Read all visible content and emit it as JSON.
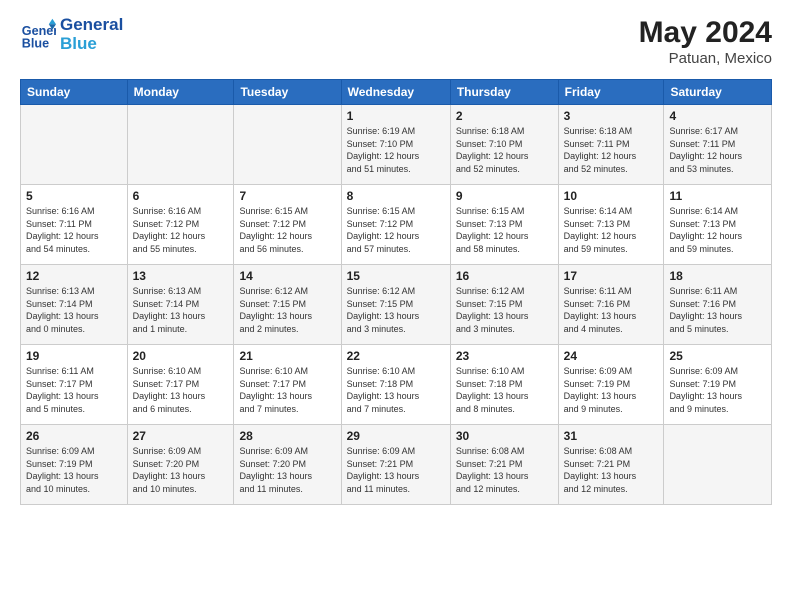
{
  "logo": {
    "name": "GeneralBlue",
    "line1": "General",
    "line2": "Blue"
  },
  "title": {
    "month_year": "May 2024",
    "location": "Patuan, Mexico"
  },
  "days_of_week": [
    "Sunday",
    "Monday",
    "Tuesday",
    "Wednesday",
    "Thursday",
    "Friday",
    "Saturday"
  ],
  "weeks": [
    [
      {
        "day": "",
        "info": ""
      },
      {
        "day": "",
        "info": ""
      },
      {
        "day": "",
        "info": ""
      },
      {
        "day": "1",
        "info": "Sunrise: 6:19 AM\nSunset: 7:10 PM\nDaylight: 12 hours\nand 51 minutes."
      },
      {
        "day": "2",
        "info": "Sunrise: 6:18 AM\nSunset: 7:10 PM\nDaylight: 12 hours\nand 52 minutes."
      },
      {
        "day": "3",
        "info": "Sunrise: 6:18 AM\nSunset: 7:11 PM\nDaylight: 12 hours\nand 52 minutes."
      },
      {
        "day": "4",
        "info": "Sunrise: 6:17 AM\nSunset: 7:11 PM\nDaylight: 12 hours\nand 53 minutes."
      }
    ],
    [
      {
        "day": "5",
        "info": "Sunrise: 6:16 AM\nSunset: 7:11 PM\nDaylight: 12 hours\nand 54 minutes."
      },
      {
        "day": "6",
        "info": "Sunrise: 6:16 AM\nSunset: 7:12 PM\nDaylight: 12 hours\nand 55 minutes."
      },
      {
        "day": "7",
        "info": "Sunrise: 6:15 AM\nSunset: 7:12 PM\nDaylight: 12 hours\nand 56 minutes."
      },
      {
        "day": "8",
        "info": "Sunrise: 6:15 AM\nSunset: 7:12 PM\nDaylight: 12 hours\nand 57 minutes."
      },
      {
        "day": "9",
        "info": "Sunrise: 6:15 AM\nSunset: 7:13 PM\nDaylight: 12 hours\nand 58 minutes."
      },
      {
        "day": "10",
        "info": "Sunrise: 6:14 AM\nSunset: 7:13 PM\nDaylight: 12 hours\nand 59 minutes."
      },
      {
        "day": "11",
        "info": "Sunrise: 6:14 AM\nSunset: 7:13 PM\nDaylight: 12 hours\nand 59 minutes."
      }
    ],
    [
      {
        "day": "12",
        "info": "Sunrise: 6:13 AM\nSunset: 7:14 PM\nDaylight: 13 hours\nand 0 minutes."
      },
      {
        "day": "13",
        "info": "Sunrise: 6:13 AM\nSunset: 7:14 PM\nDaylight: 13 hours\nand 1 minute."
      },
      {
        "day": "14",
        "info": "Sunrise: 6:12 AM\nSunset: 7:15 PM\nDaylight: 13 hours\nand 2 minutes."
      },
      {
        "day": "15",
        "info": "Sunrise: 6:12 AM\nSunset: 7:15 PM\nDaylight: 13 hours\nand 3 minutes."
      },
      {
        "day": "16",
        "info": "Sunrise: 6:12 AM\nSunset: 7:15 PM\nDaylight: 13 hours\nand 3 minutes."
      },
      {
        "day": "17",
        "info": "Sunrise: 6:11 AM\nSunset: 7:16 PM\nDaylight: 13 hours\nand 4 minutes."
      },
      {
        "day": "18",
        "info": "Sunrise: 6:11 AM\nSunset: 7:16 PM\nDaylight: 13 hours\nand 5 minutes."
      }
    ],
    [
      {
        "day": "19",
        "info": "Sunrise: 6:11 AM\nSunset: 7:17 PM\nDaylight: 13 hours\nand 5 minutes."
      },
      {
        "day": "20",
        "info": "Sunrise: 6:10 AM\nSunset: 7:17 PM\nDaylight: 13 hours\nand 6 minutes."
      },
      {
        "day": "21",
        "info": "Sunrise: 6:10 AM\nSunset: 7:17 PM\nDaylight: 13 hours\nand 7 minutes."
      },
      {
        "day": "22",
        "info": "Sunrise: 6:10 AM\nSunset: 7:18 PM\nDaylight: 13 hours\nand 7 minutes."
      },
      {
        "day": "23",
        "info": "Sunrise: 6:10 AM\nSunset: 7:18 PM\nDaylight: 13 hours\nand 8 minutes."
      },
      {
        "day": "24",
        "info": "Sunrise: 6:09 AM\nSunset: 7:19 PM\nDaylight: 13 hours\nand 9 minutes."
      },
      {
        "day": "25",
        "info": "Sunrise: 6:09 AM\nSunset: 7:19 PM\nDaylight: 13 hours\nand 9 minutes."
      }
    ],
    [
      {
        "day": "26",
        "info": "Sunrise: 6:09 AM\nSunset: 7:19 PM\nDaylight: 13 hours\nand 10 minutes."
      },
      {
        "day": "27",
        "info": "Sunrise: 6:09 AM\nSunset: 7:20 PM\nDaylight: 13 hours\nand 10 minutes."
      },
      {
        "day": "28",
        "info": "Sunrise: 6:09 AM\nSunset: 7:20 PM\nDaylight: 13 hours\nand 11 minutes."
      },
      {
        "day": "29",
        "info": "Sunrise: 6:09 AM\nSunset: 7:21 PM\nDaylight: 13 hours\nand 11 minutes."
      },
      {
        "day": "30",
        "info": "Sunrise: 6:08 AM\nSunset: 7:21 PM\nDaylight: 13 hours\nand 12 minutes."
      },
      {
        "day": "31",
        "info": "Sunrise: 6:08 AM\nSunset: 7:21 PM\nDaylight: 13 hours\nand 12 minutes."
      },
      {
        "day": "",
        "info": ""
      }
    ]
  ]
}
